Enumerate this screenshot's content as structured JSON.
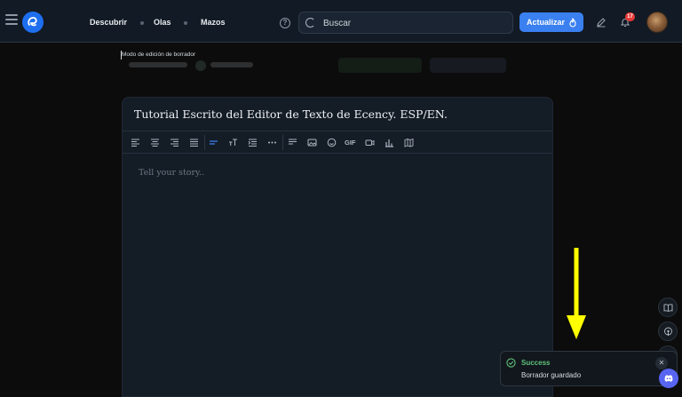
{
  "nav": {
    "links": [
      "Descubrir",
      "Olas",
      "Mazos"
    ],
    "search_placeholder": "Buscar",
    "update_label": "Actualizar",
    "notifications_count": "17"
  },
  "draft": {
    "mode_label": "Modo de edición de borrador"
  },
  "editor": {
    "title": "Tutorial Escrito del Editor de Texto de Ecency. ESP/EN.",
    "placeholder": "Tell your story.."
  },
  "toast": {
    "title": "Success",
    "message": "Borrador guardado"
  },
  "colors": {
    "accent": "#3a80f0",
    "success": "#5fc27a",
    "annotation_arrow": "#ffff00"
  }
}
